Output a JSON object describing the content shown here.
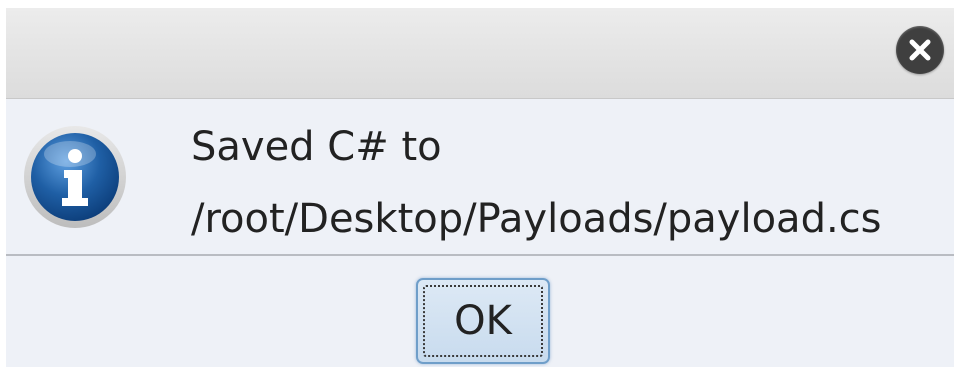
{
  "dialog": {
    "close_icon": "close-icon",
    "info_icon": "info-icon",
    "message_line1": "Saved C# to",
    "message_line2": "/root/Desktop/Payloads/payload.cs",
    "ok_label": "OK"
  },
  "colors": {
    "close_button": "#3f3f3f",
    "info_blue": "#1f5fa5",
    "button_border": "#6f9ec9"
  }
}
